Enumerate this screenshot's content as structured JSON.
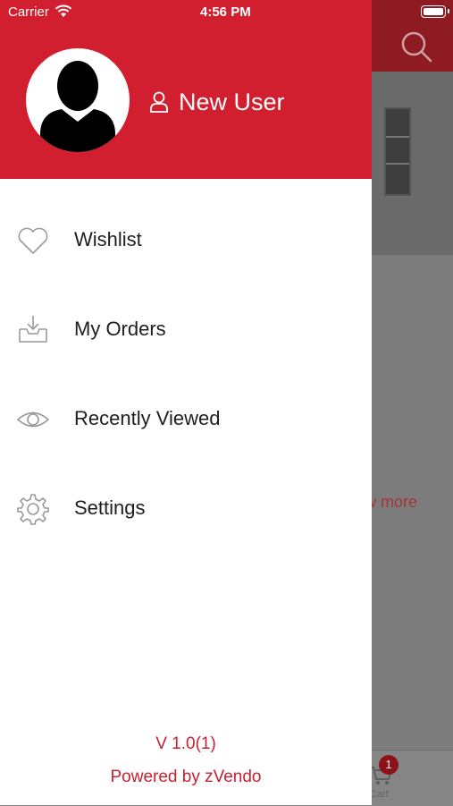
{
  "status_bar": {
    "carrier": "Carrier",
    "time": "4:56 PM"
  },
  "drawer": {
    "user_name": "New User",
    "menu": [
      {
        "label": "Wishlist",
        "icon": "heart-icon"
      },
      {
        "label": "My Orders",
        "icon": "inbox-download-icon"
      },
      {
        "label": "Recently Viewed",
        "icon": "eye-icon"
      },
      {
        "label": "Settings",
        "icon": "gear-icon"
      }
    ],
    "version": "V 1.0(1)",
    "powered_by": "Powered by zVendo"
  },
  "background": {
    "show_more_fragment": "ow more",
    "cart_label": "Cart",
    "cart_badge": "1"
  },
  "colors": {
    "accent": "#d21f30",
    "text": "#1e1e1e",
    "footer_text": "#c92032"
  }
}
